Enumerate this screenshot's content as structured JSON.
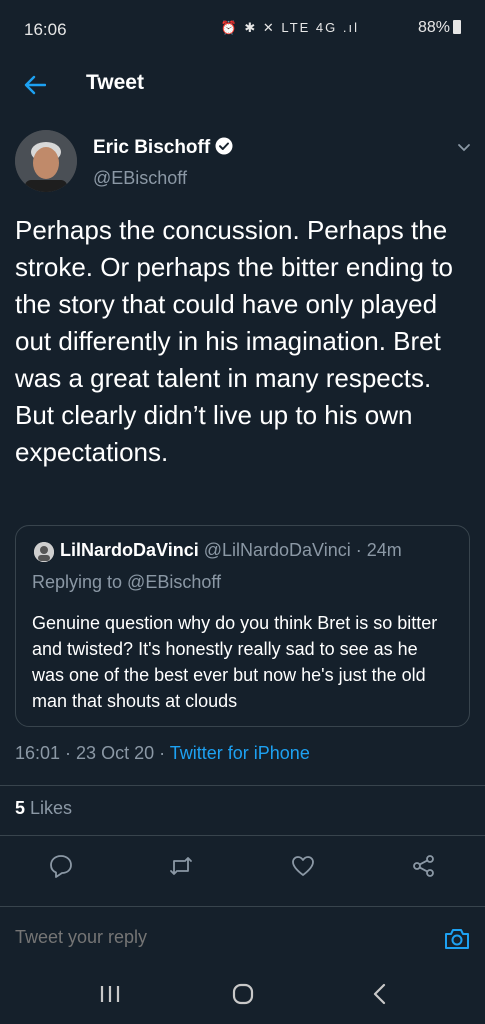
{
  "status": {
    "time": "16:06",
    "icons": "⏰ ✱ ✕ LTE 4G .ıl",
    "battery": "88%"
  },
  "header": {
    "title": "Tweet"
  },
  "tweet": {
    "author_name": "Eric Bischoff",
    "author_handle": "@EBischoff",
    "text": "Perhaps the concussion. Perhaps the stroke. Or perhaps the bitter ending to the story that could have only played out differently in his imagination. Bret was a great talent in many respects. But clearly didn’t live up to his own expectations.",
    "time": "16:01",
    "date": "23 Oct 20",
    "source": "Twitter for iPhone",
    "likes_count": "5",
    "likes_label": "Likes"
  },
  "quote": {
    "name": "LilNardoDaVinci",
    "handle": "@LilNardoDaVinci",
    "age": "24m",
    "replying_to": "Replying to @EBischoff",
    "text": "Genuine question why do you think Bret is so bitter and twisted? It's honestly really sad to see as he was one of the best ever but now he's just the old man that shouts at clouds"
  },
  "reply": {
    "placeholder": "Tweet your reply"
  },
  "colors": {
    "background": "#15202b",
    "accent": "#1da1f2",
    "muted": "#8b98a5",
    "divider": "#38444d"
  }
}
